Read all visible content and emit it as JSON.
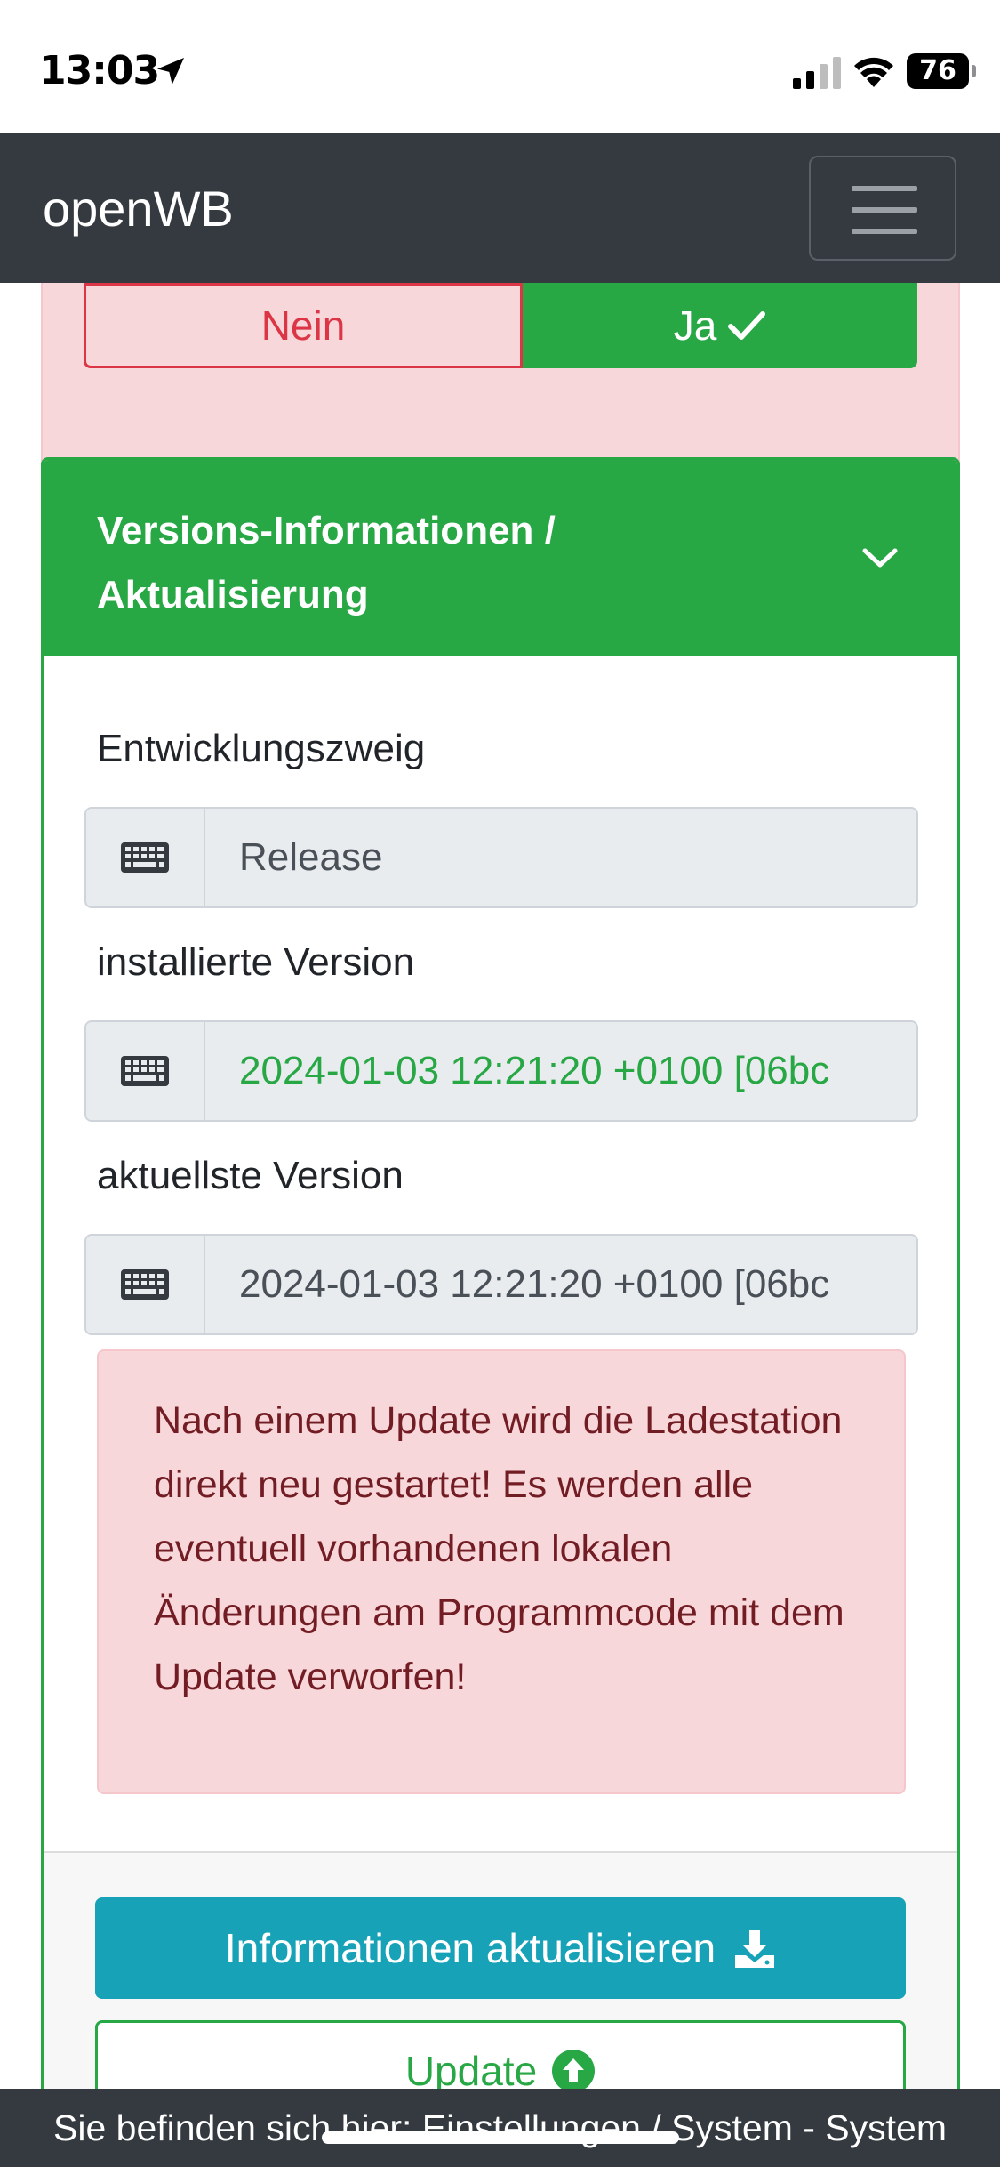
{
  "status_bar": {
    "time": "13:03",
    "battery": "76"
  },
  "navbar": {
    "brand": "openWB"
  },
  "confirm": {
    "no_label": "Nein",
    "yes_label": "Ja"
  },
  "versions_card": {
    "title": "Versions-Informationen / Aktualisierung",
    "branch_label": "Entwicklungszweig",
    "branch_value": "Release",
    "installed_label": "installierte Version",
    "installed_value": "2024-01-03 12:21:20 +0100 [06bc",
    "latest_label": "aktuellste Version",
    "latest_value": "2024-01-03 12:21:20 +0100 [06bc",
    "warning": "Nach einem Update wird die Ladestation direkt neu gestartet! Es werden alle eventuell vorhandenen lokalen Änderungen am Programmcode mit dem Update verworfen!",
    "refresh_button": "Informationen aktualisieren",
    "update_button": "Update"
  },
  "footer": {
    "breadcrumb": "Sie befinden sich hier: Einstellungen / System - System"
  },
  "colors": {
    "success": "#28a745",
    "danger": "#dc3545",
    "info": "#17a2b8",
    "dark": "#343a40"
  },
  "icons": [
    "location-arrow-icon",
    "cellular-signal-icon",
    "wifi-icon",
    "battery-icon",
    "hamburger-menu-icon",
    "check-icon",
    "chevron-down-icon",
    "keyboard-icon",
    "download-icon",
    "arrow-circle-up-icon"
  ]
}
